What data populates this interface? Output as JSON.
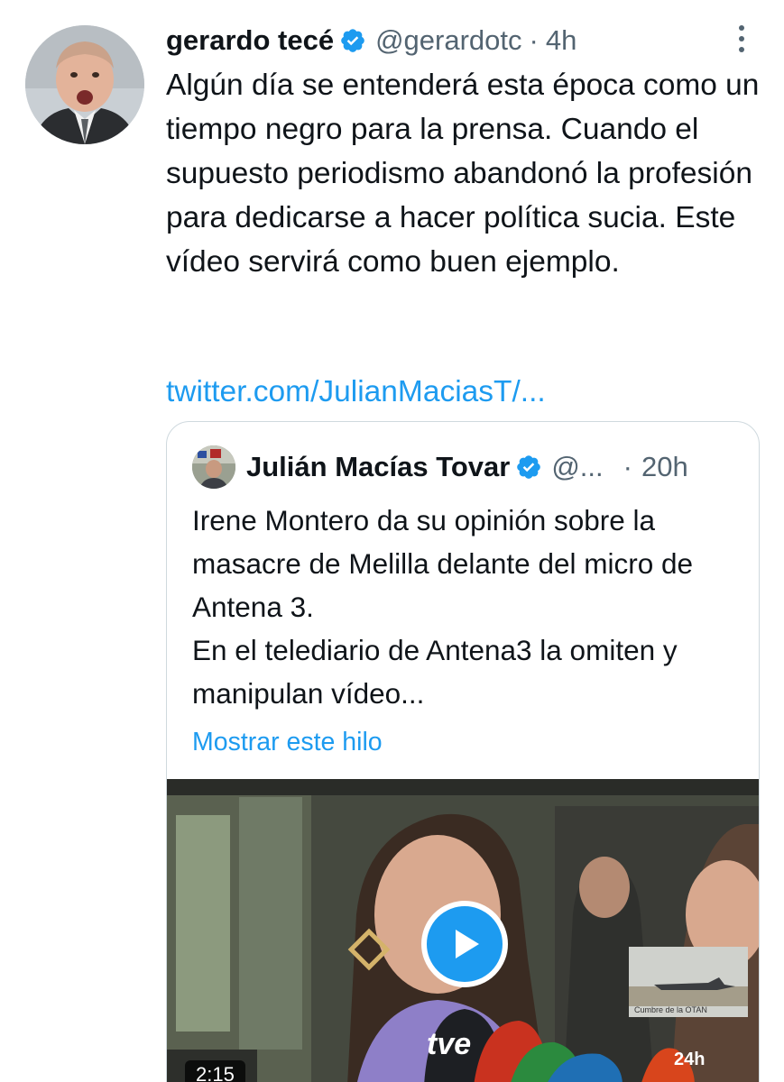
{
  "tweet": {
    "author": {
      "display_name": "gerardo tecé",
      "handle": "@gerardotc",
      "separator": "·",
      "time": "4h",
      "avatar_icon": "person-avatar"
    },
    "body": "Algún día se entenderá esta época como un tiempo negro para la prensa. Cuando el supuesto periodismo abandonó la profesión para dedicarse a hacer política sucia. Este vídeo servirá como buen ejemplo.",
    "link": "twitter.com/JulianMaciasT/...",
    "more_icon": "more-vertical-icon",
    "verified_icon": "verified-badge-icon"
  },
  "quote": {
    "author": {
      "display_name": "Julián Macías Tovar",
      "handle": "@...",
      "separator": "·",
      "time": "20h"
    },
    "text_line1": "Irene Montero da su opinión sobre la masacre de Melilla delante del micro de Antena 3.",
    "text_line2": "En el telediario de Antena3 la omiten y manipulan vídeo...",
    "show_thread": "Mostrar este hilo",
    "video": {
      "duration": "2:15",
      "channel_badge": "24h",
      "mic_label": "tve",
      "inset_caption": "Cumbre de la OTAN",
      "play_icon": "play-icon"
    }
  },
  "colors": {
    "accent": "#1d9bf0",
    "text": "#0f1419",
    "secondary": "#536471",
    "border": "#cfd9de"
  }
}
